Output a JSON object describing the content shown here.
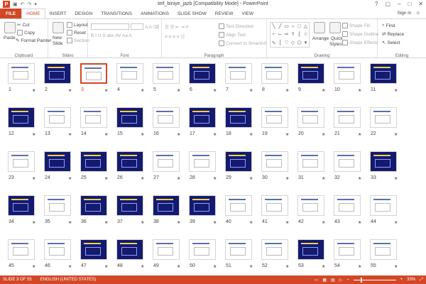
{
  "app": {
    "title": "teif_biniye_jazb [Compatibility Mode] - PowerPoint",
    "logo": "P",
    "qat_icons": [
      "save-icon",
      "undo-icon",
      "redo-icon",
      "customize-icon"
    ],
    "window_controls": [
      "?",
      "▢",
      "–",
      "□",
      "✕"
    ]
  },
  "tabs": [
    "FILE",
    "HOME",
    "INSERT",
    "DESIGN",
    "TRANSITIONS",
    "ANIMATIONS",
    "SLIDE SHOW",
    "REVIEW",
    "VIEW"
  ],
  "active_tab": "HOME",
  "signin": "Sign in",
  "ribbon": {
    "clipboard": {
      "label": "Clipboard",
      "paste": "Paste",
      "cut": "Cut",
      "copy": "Copy",
      "format_painter": "Format Painter"
    },
    "slides": {
      "label": "Slides",
      "new_slide": "New",
      "new_slide2": "Slide",
      "layout": "Layout",
      "reset": "Reset",
      "section": "Section"
    },
    "font": {
      "label": "Font"
    },
    "paragraph": {
      "label": "Paragraph",
      "text_direction": "Text Direction",
      "align_text": "Align Text",
      "convert": "Convert to SmartArt"
    },
    "drawing": {
      "label": "Drawing",
      "arrange": "Arrange",
      "quick_styles": "Quick",
      "quick_styles2": "Styles",
      "shape_fill": "Shape Fill",
      "shape_outline": "Shape Outline",
      "shape_effects": "Shape Effects"
    },
    "editing": {
      "label": "Editing",
      "find": "Find",
      "replace": "Replace",
      "select": "Select"
    }
  },
  "slides": {
    "selected": 3,
    "count": 55,
    "star": "★",
    "themes": [
      "w",
      "n",
      "w",
      "w",
      "w",
      "n",
      "w",
      "w",
      "n",
      "w",
      "n",
      "n",
      "w",
      "w",
      "n",
      "w",
      "n",
      "n",
      "w",
      "w",
      "w",
      "w",
      "w",
      "n",
      "n",
      "n",
      "w",
      "w",
      "n",
      "w",
      "w",
      "w",
      "n",
      "n",
      "w",
      "n",
      "n",
      "n",
      "n",
      "w",
      "w",
      "w",
      "w",
      "w",
      "w",
      "w",
      "n",
      "n",
      "w",
      "w",
      "w",
      "w",
      "n",
      "w",
      "w",
      "w",
      "w",
      "w",
      "n",
      "w",
      "w",
      "w",
      "w",
      "w",
      "n"
    ]
  },
  "status": {
    "slide": "SLIDE 3 OF 55",
    "language": "ENGLISH (UNITED STATES)",
    "zoom": "33%"
  },
  "colors": {
    "accent": "#d24726",
    "navy": "#141a6e",
    "white": "#ffffff"
  }
}
